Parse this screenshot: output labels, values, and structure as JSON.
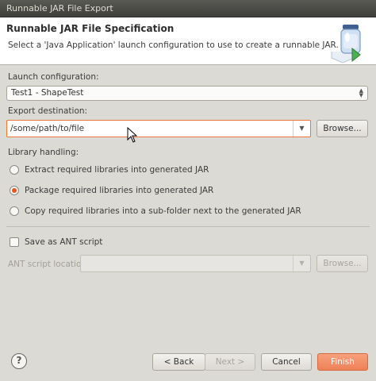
{
  "window": {
    "title": "Runnable JAR File Export"
  },
  "header": {
    "title": "Runnable JAR File Specification",
    "description": "Select a 'Java Application' launch configuration to use to create a runnable JAR.",
    "icon": "jar-export-icon"
  },
  "launch": {
    "label": "Launch configuration:",
    "selected": "Test1 - ShapeTest"
  },
  "export": {
    "label": "Export destination:",
    "value": "/some/path/to/file",
    "browse_label": "Browse..."
  },
  "library": {
    "label": "Library handling:",
    "options": [
      {
        "label": "Extract required libraries into generated JAR",
        "checked": false
      },
      {
        "label": "Package required libraries into generated JAR",
        "checked": true
      },
      {
        "label": "Copy required libraries into a sub-folder next to the generated JAR",
        "checked": false
      }
    ]
  },
  "ant": {
    "checkbox_label": "Save as ANT script",
    "checked": false,
    "location_label": "ANT script location:",
    "value": "",
    "browse_label": "Browse..."
  },
  "buttons": {
    "back": "< Back",
    "next": "Next >",
    "cancel": "Cancel",
    "finish": "Finish",
    "help": "?"
  },
  "colors": {
    "accent": "#e95420",
    "focus_border": "#e9763c",
    "finish": "#ee8157"
  }
}
